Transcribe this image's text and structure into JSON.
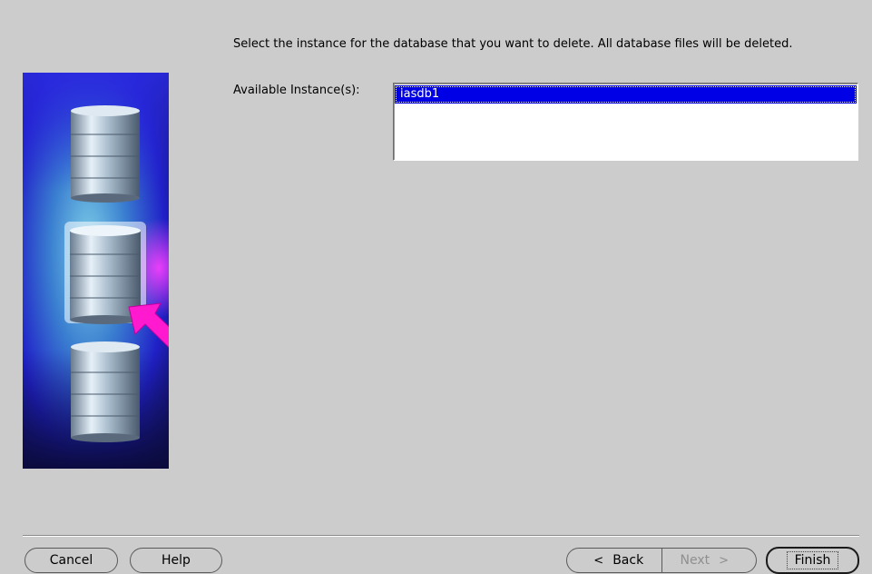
{
  "instruction_text": "Select the instance for the database that you want to delete. All database files will be deleted.",
  "instances_label": "Available Instance(s):",
  "instances": [
    "iasdb1"
  ],
  "selected_instance": "iasdb1",
  "buttons": {
    "cancel": "Cancel",
    "help": "Help",
    "back": "Back",
    "next": "Next",
    "finish": "Finish"
  },
  "icons": {
    "back_arrow": "<",
    "next_arrow": ">"
  },
  "colors": {
    "selection": "#0000e6",
    "background": "#cccccc",
    "arrow_magenta": "#ff00cc"
  }
}
